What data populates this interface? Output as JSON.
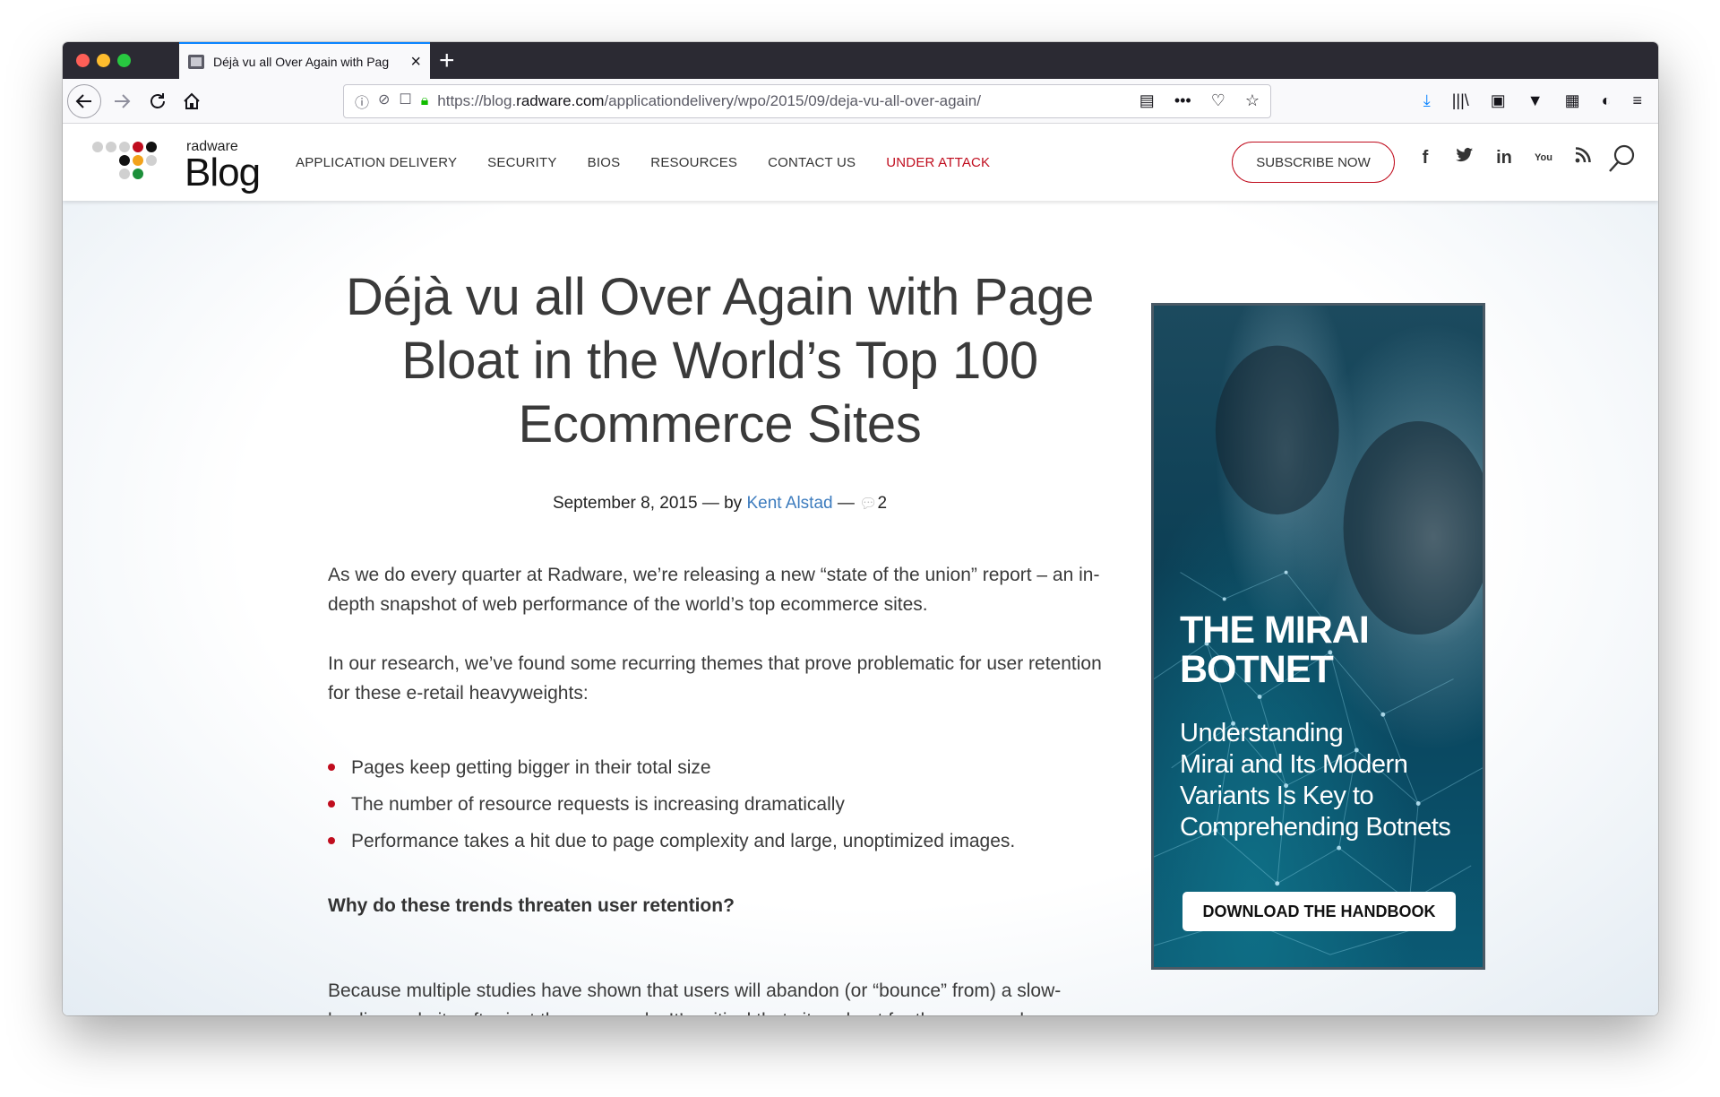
{
  "browser": {
    "tab_title": "Déjà vu all Over Again with Pag",
    "url_prefix": "https://blog.",
    "url_domain": "radware.com",
    "url_path": "/applicationdelivery/wpo/2015/09/deja-vu-all-over-again/"
  },
  "site": {
    "logo_small": "radware",
    "logo_big": "Blog",
    "nav": [
      "APPLICATION DELIVERY",
      "SECURITY",
      "BIOS",
      "RESOURCES",
      "CONTACT US",
      "UNDER ATTACK"
    ],
    "subscribe_label": "SUBSCRIBE NOW",
    "social": {
      "facebook": "f",
      "linkedin": "in",
      "youtube": "You"
    }
  },
  "article": {
    "title": "Déjà vu all Over Again with Page Bloat in the World’s Top 100 Ecommerce Sites",
    "date": "September 8, 2015",
    "by": " — by ",
    "author": "Kent Alstad",
    "dash": " — ",
    "comment_count": "2",
    "para1": "As we do every quarter at Radware, we’re releasing a new “state of the union” report – an in-depth snapshot of web performance of the world’s top ecommerce sites.",
    "para2": "In our research, we’ve found some recurring themes that prove problematic for user retention for these e-retail heavyweights:",
    "bullets": [
      "Pages keep getting bigger in their total size",
      "The number of resource requests is increasing dramatically",
      "Performance takes a hit due to page complexity and large, unoptimized images."
    ],
    "subhead": "Why do these trends threaten user retention?",
    "para3": "Because multiple studies have shown that users will abandon (or “bounce” from) a slow-loading website after just three seconds. It’s critical that sites shoot for three seconds or"
  },
  "ad": {
    "title_line1": "THE MIRAI",
    "title_line2": "BOTNET",
    "sub_line1": "Understanding",
    "sub_line2": "Mirai and Its Modern",
    "sub_line3": "Variants Is Key to",
    "sub_line4": "Comprehending Botnets",
    "button": "DOWNLOAD THE HANDBOOK"
  },
  "colors": {
    "accent_red": "#c00d1e",
    "link_blue": "#3d7cbe",
    "browser_accent": "#0a84ff"
  }
}
